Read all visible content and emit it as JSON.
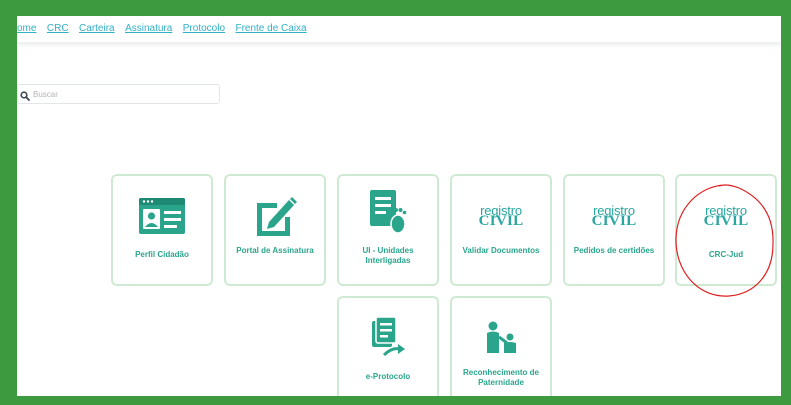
{
  "topnav": {
    "links": [
      "ome",
      "CRC",
      "Carteira",
      "Assinatura",
      "Protocolo",
      "Frente de Caixa"
    ]
  },
  "search": {
    "placeholder": "Buscar"
  },
  "tiles": [
    {
      "label": "Perfil Cidadão",
      "icon": "profile-card-icon"
    },
    {
      "label": "Portal de Assinatura",
      "icon": "edit-pencil-icon"
    },
    {
      "label": "UI - Unidades Interligadas",
      "icon": "document-footprint-icon"
    },
    {
      "label": "Validar Documentos",
      "icon": "registro-civil-logo"
    },
    {
      "label": "Pedidos de certidões",
      "icon": "registro-civil-logo"
    },
    {
      "label": "CRC-Jud",
      "icon": "registro-civil-logo"
    },
    {
      "label": "e-Protocolo",
      "icon": "document-arrow-icon"
    },
    {
      "label": "Reconhecimento de Paternidade",
      "icon": "parent-child-icon"
    }
  ],
  "logo": {
    "line1": "registro",
    "line2": "CIVIL"
  },
  "colors": {
    "frame": "#3e9a3e",
    "link": "#31b0c8",
    "tile_border": "#cfead2",
    "tile_text": "#2aa58c",
    "annotation": "#e02020"
  }
}
